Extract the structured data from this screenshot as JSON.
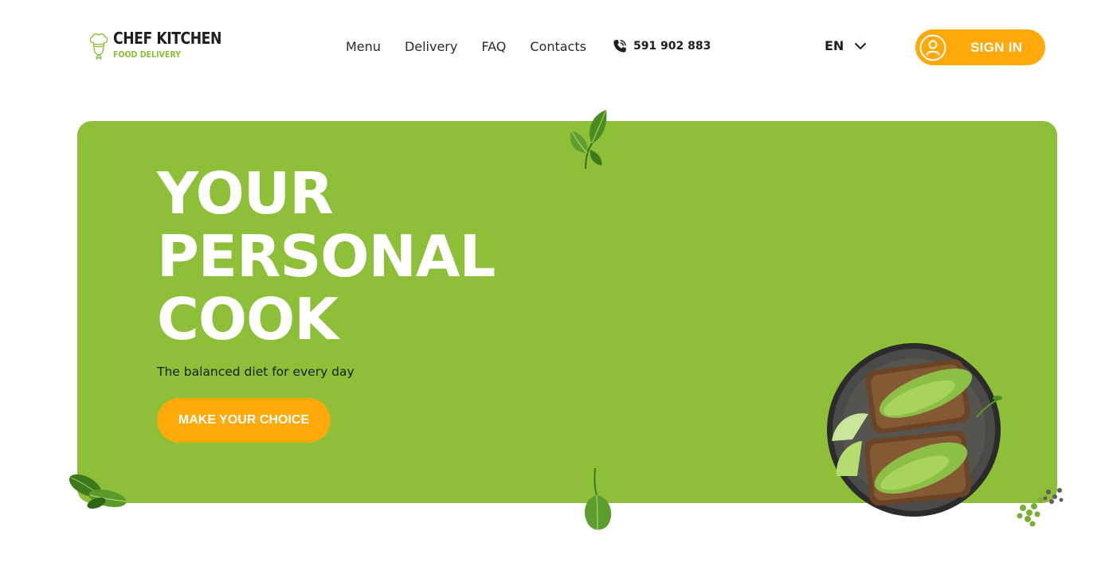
{
  "brand": {
    "name": "CHEF KITCHEN",
    "tagline": "FOOD DELIVERY"
  },
  "nav": {
    "items": [
      {
        "label": "Menu"
      },
      {
        "label": "Delivery"
      },
      {
        "label": "FAQ"
      },
      {
        "label": "Contacts"
      }
    ],
    "phone": "591 902 883"
  },
  "language": {
    "selected": "EN"
  },
  "auth": {
    "sign_in_label": "SIGN IN"
  },
  "hero": {
    "headline": [
      "YOUR",
      "PERSONAL",
      "COOK"
    ],
    "subtitle": "The balanced diet for every day",
    "cta_label": "MAKE YOUR CHOICE"
  },
  "icons": {
    "logo": "chef-hat-icon",
    "phone": "phone-icon",
    "language": "chevron-down-icon",
    "sign_in": "user-icon"
  },
  "colors": {
    "brand_green": "#8ebf38",
    "accent_orange": "#ffa90a",
    "text_dark": "#1e1e1e",
    "white": "#ffffff"
  }
}
